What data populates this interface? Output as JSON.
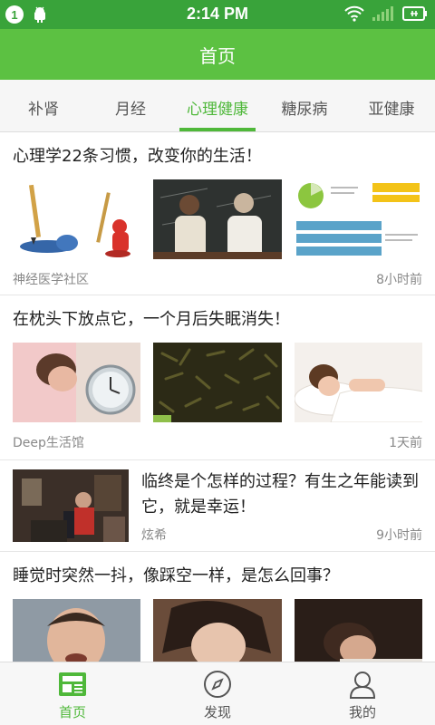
{
  "status": {
    "notification_count": "1",
    "time": "2:14 PM"
  },
  "app": {
    "title": "首页"
  },
  "tabs": [
    "补肾",
    "月经",
    "心理健康",
    "糖尿病",
    "亚健康"
  ],
  "articles": [
    {
      "title": "心理学22条习惯，改变你的生活！",
      "source": "神经医学社区",
      "time": "8小时前"
    },
    {
      "title": "在枕头下放点它，一个月后失眠消失！",
      "source": "Deep生活馆",
      "time": "1天前"
    },
    {
      "title": "临终是个怎样的过程？有生之年能读到它，就是幸运！",
      "source": "炫希",
      "time": "9小时前"
    },
    {
      "title": "睡觉时突然一抖，像踩空一样，是怎么回事？"
    }
  ],
  "bottom_nav": [
    "首页",
    "发现",
    "我的"
  ],
  "colors": {
    "status": "#39a33a",
    "appbar": "#5cc142",
    "accent": "#4fb83a"
  }
}
